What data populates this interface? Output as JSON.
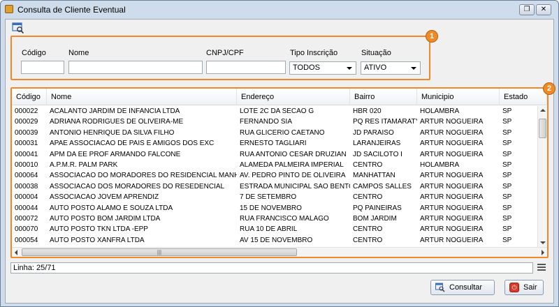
{
  "window": {
    "title": "Consulta de Cliente Eventual",
    "restore_label": "❐",
    "close_label": "✕"
  },
  "toolbar": {
    "icon": "search-window-icon"
  },
  "filters": {
    "badge": "1",
    "codigo_label": "Código",
    "codigo_value": "",
    "nome_label": "Nome",
    "nome_value": "",
    "cnpj_label": "CNPJ/CPF",
    "cnpj_value": "",
    "tipo_label": "Tipo Inscrição",
    "tipo_value": "TODOS",
    "situacao_label": "Situação",
    "situacao_value": "ATIVO"
  },
  "grid": {
    "badge": "2",
    "columns": [
      "Código",
      "Nome",
      "Endereço",
      "Bairro",
      "Municipio",
      "Estado"
    ],
    "rows": [
      [
        "000022",
        "ACALANTO JARDIM DE INFANCIA LTDA",
        "LOTE 2C DA SECAO G",
        "HBR 020",
        "HOLAMBRA",
        "SP"
      ],
      [
        "000029",
        "ADRIANA RODRIGUES DE OLIVEIRA-ME",
        "FERNANDO SIA",
        "PQ RES ITAMARATY",
        "ARTUR NOGUEIRA",
        "SP"
      ],
      [
        "000039",
        "ANTONIO HENRIQUE DA SILVA FILHO",
        "RUA GLICERIO CAETANO",
        "JD PARAISO",
        "ARTUR NOGUEIRA",
        "SP"
      ],
      [
        "000031",
        "APAE ASSOCIACAO DE PAIS E AMIGOS DOS EXC",
        "ERNESTO TAGLIARI",
        "LARANJEIRAS",
        "ARTUR NOGUEIRA",
        "SP"
      ],
      [
        "000041",
        "APM DA EE PROF ARMANDO FALCONE",
        "RUA ANTONIO CESAR DRUZIAN",
        "JD SACILOTO I",
        "ARTUR NOGUEIRA",
        "SP"
      ],
      [
        "000010",
        "A.P.M.R. PALM PARK",
        "ALAMEDA PALMEIRA IMPERIAL",
        "CENTRO",
        "HOLAMBRA",
        "SP"
      ],
      [
        "000064",
        "ASSOCIACAO DO MORADORES DO RESIDENCIAL MANH...",
        "AV. PEDRO PINTO DE OLIVEIRA",
        "MANHATTAN",
        "ARTUR NOGUEIRA",
        "SP"
      ],
      [
        "000038",
        "ASSOCIACAO  DOS MORADORES DO RESEDENCIAL",
        "ESTRADA MUNICIPAL SAO BENTO",
        "CAMPOS SALLES",
        "ARTUR NOGUEIRA",
        "SP"
      ],
      [
        "000004",
        "ASSOCIACAO JOVEM APRENDIZ",
        "7 DE SETEMBRO",
        "CENTRO",
        "ARTUR NOGUEIRA",
        "SP"
      ],
      [
        "000044",
        "AUTO POSTO ALAMO E SOUZA LTDA",
        "15 DE NOVEMBRO",
        "PQ PAINEIRAS",
        "ARTUR NOGUEIRA",
        "SP"
      ],
      [
        "000072",
        "AUTO POSTO BOM JARDIM LTDA",
        "RUA FRANCISCO MALAGO",
        "BOM JARDIM",
        "ARTUR NOGUEIRA",
        "SP"
      ],
      [
        "000070",
        "AUTO POSTO TKN LTDA -EPP",
        "RUA 10 DE ABRIL",
        "CENTRO",
        "ARTUR NOGUEIRA",
        "SP"
      ],
      [
        "000054",
        "AUTO POSTO XANFRA LTDA",
        "AV 15 DE NOVEMBRO",
        "CENTRO",
        "ARTUR NOGUEIRA",
        "SP"
      ]
    ],
    "hscroll_grip": "|||"
  },
  "status": {
    "text": "Linha: 25/71"
  },
  "buttons": {
    "consultar": "Consultar",
    "sair": "Sair",
    "sair_icon": "⏻"
  },
  "colors": {
    "highlight_frame": "#f0882a",
    "badge": "#f08a24"
  }
}
